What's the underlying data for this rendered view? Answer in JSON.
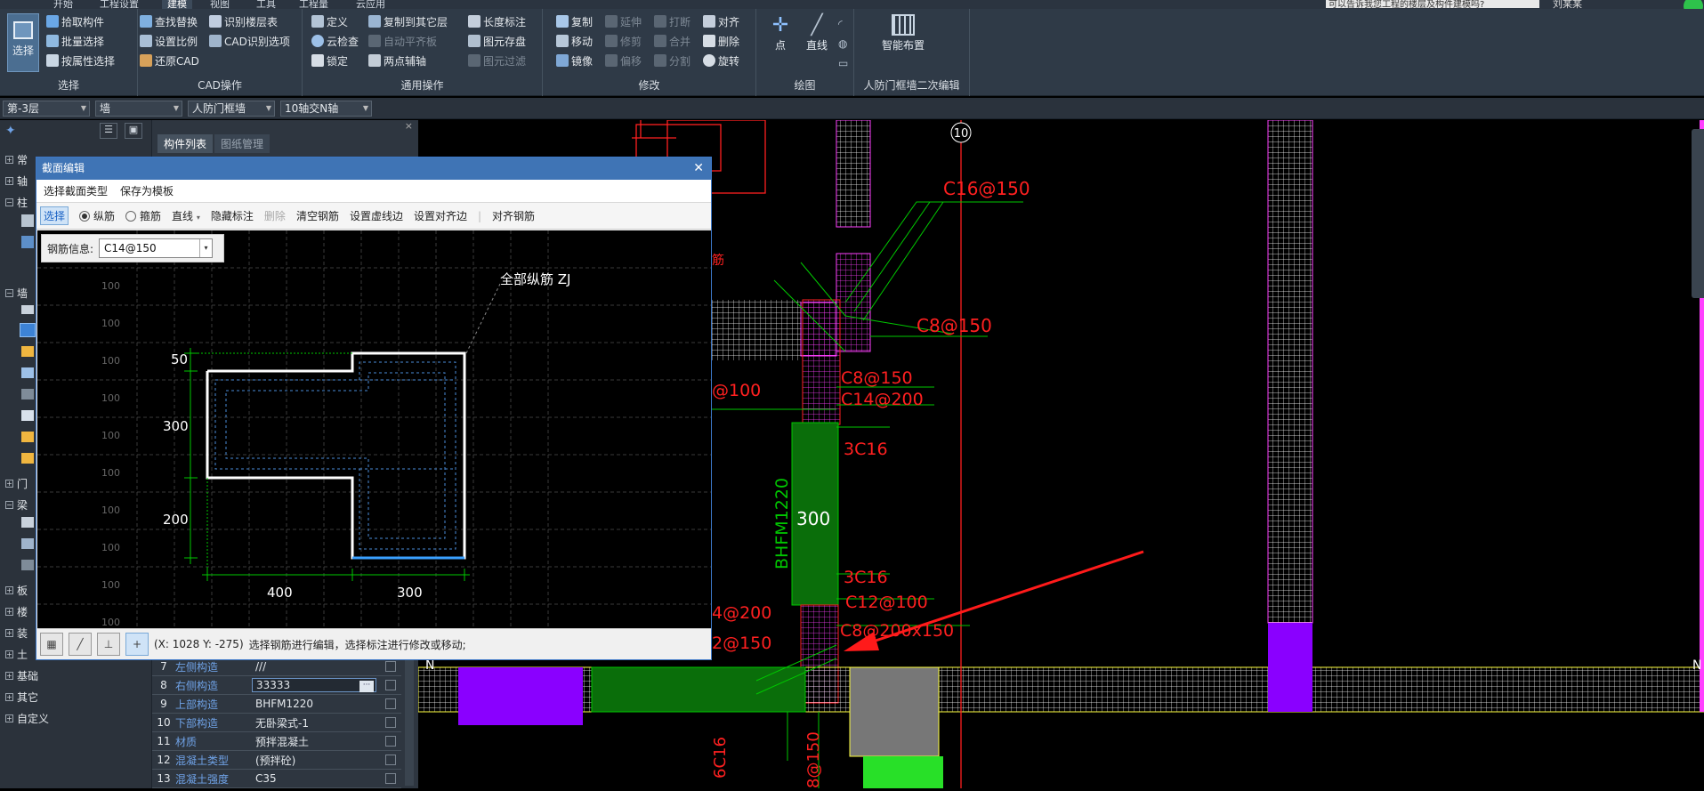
{
  "top_tabs": [
    "开始",
    "工程设置",
    "建模",
    "视图",
    "工具",
    "工程量",
    "云应用"
  ],
  "top_hint": "可以告诉我您工程的楼层及构件建模吗?",
  "user_name": "刘某某",
  "ribbon": {
    "select_group": {
      "title": "选择",
      "big_button": "选择",
      "items": [
        "拾取构件",
        "批量选择",
        "按属性选择"
      ]
    },
    "cad_group": {
      "title": "CAD操作",
      "items": [
        "查找替换",
        "识别楼层表",
        "设置比例",
        "CAD识别选项",
        "还原CAD"
      ]
    },
    "common_group": {
      "title": "通用操作",
      "items": [
        "定义",
        "复制到其它层",
        "长度标注",
        "云检查",
        "自动平齐板",
        "图元存盘",
        "锁定",
        "两点辅轴",
        "图元过滤"
      ]
    },
    "modify_group": {
      "title": "修改",
      "items": [
        "复制",
        "延伸",
        "打断",
        "对齐",
        "移动",
        "修剪",
        "合并",
        "删除",
        "镜像",
        "偏移",
        "分割",
        "旋转"
      ]
    },
    "draw_group": {
      "title": "绘图",
      "items": [
        "点",
        "直线"
      ]
    },
    "smart_group": {
      "title": "人防门框墙二次编辑",
      "big_button": "智能布置"
    }
  },
  "props_bar": {
    "floor": "第-3层",
    "type": "墙",
    "subtype": "人防门框墙",
    "axis": "10轴交N轴"
  },
  "left_nav": {
    "items": [
      "常",
      "轴",
      "柱",
      "墙",
      "门",
      "梁",
      "板",
      "楼",
      "装",
      "土",
      "基础",
      "其它",
      "自定义"
    ]
  },
  "mid_panel": {
    "tabs": [
      "构件列表",
      "图纸管理"
    ],
    "rows": [
      {
        "no": "7",
        "name": "左侧构造",
        "value": "///"
      },
      {
        "no": "8",
        "name": "右侧构造",
        "value": "33333"
      },
      {
        "no": "9",
        "name": "上部构造",
        "value": "BHFM1220"
      },
      {
        "no": "10",
        "name": "下部构造",
        "value": "无卧梁式-1"
      },
      {
        "no": "11",
        "name": "材质",
        "value": "预拌混凝土"
      },
      {
        "no": "12",
        "name": "混凝土类型",
        "value": "(预拌砼)"
      },
      {
        "no": "13",
        "name": "混凝土强度",
        "value": "C35"
      }
    ]
  },
  "dialog": {
    "title": "截面编辑",
    "menu": [
      "选择截面类型",
      "保存为模板"
    ],
    "toolbar": {
      "select": "选择",
      "longitudinal": "纵筋",
      "stirrup": "箍筋",
      "line": "直线",
      "hide_dim": "隐藏标注",
      "delete": "删除",
      "clear": "清空钢筋",
      "virtual_edge": "设置虚线边",
      "align_edge": "设置对齐边",
      "align_rebar": "对齐钢筋"
    },
    "rebar_info_label": "钢筋信息:",
    "rebar_info_value": "C14@150",
    "annotation": "全部纵筋 ZJ",
    "grid_labels": [
      "100",
      "100",
      "100",
      "100",
      "100",
      "100",
      "100",
      "100",
      "100",
      "100"
    ],
    "dims": {
      "left_top": "50",
      "left_mid": "300",
      "left_bottom": "200",
      "bottom_left": "400",
      "bottom_right": "300"
    },
    "status_coords": "(X: 1028 Y: -275)",
    "status_text": "选择钢筋进行编辑，选择标注进行修改或移动;"
  },
  "cad": {
    "axis_label": "10",
    "axis_n": "N",
    "rebar_labels": [
      "C16@150",
      "C8@150",
      "C8@150",
      "C14@200",
      "3C16",
      "3C16",
      "C12@100",
      "C8@200x150",
      "@100",
      "4@200",
      "2@150",
      "筋",
      "6C16",
      "8@150"
    ],
    "door_label": "BHFM1220",
    "door_dim": "300"
  },
  "colors": {
    "ribbon_bg": "#2f3a47",
    "dialog_title": "#3f74b5",
    "cad_green": "#00c800",
    "cad_red": "#ff2020",
    "cad_magenta": "#ff40ff",
    "cad_purple": "#8a00ff",
    "arrow_red": "#ff1a1a"
  }
}
